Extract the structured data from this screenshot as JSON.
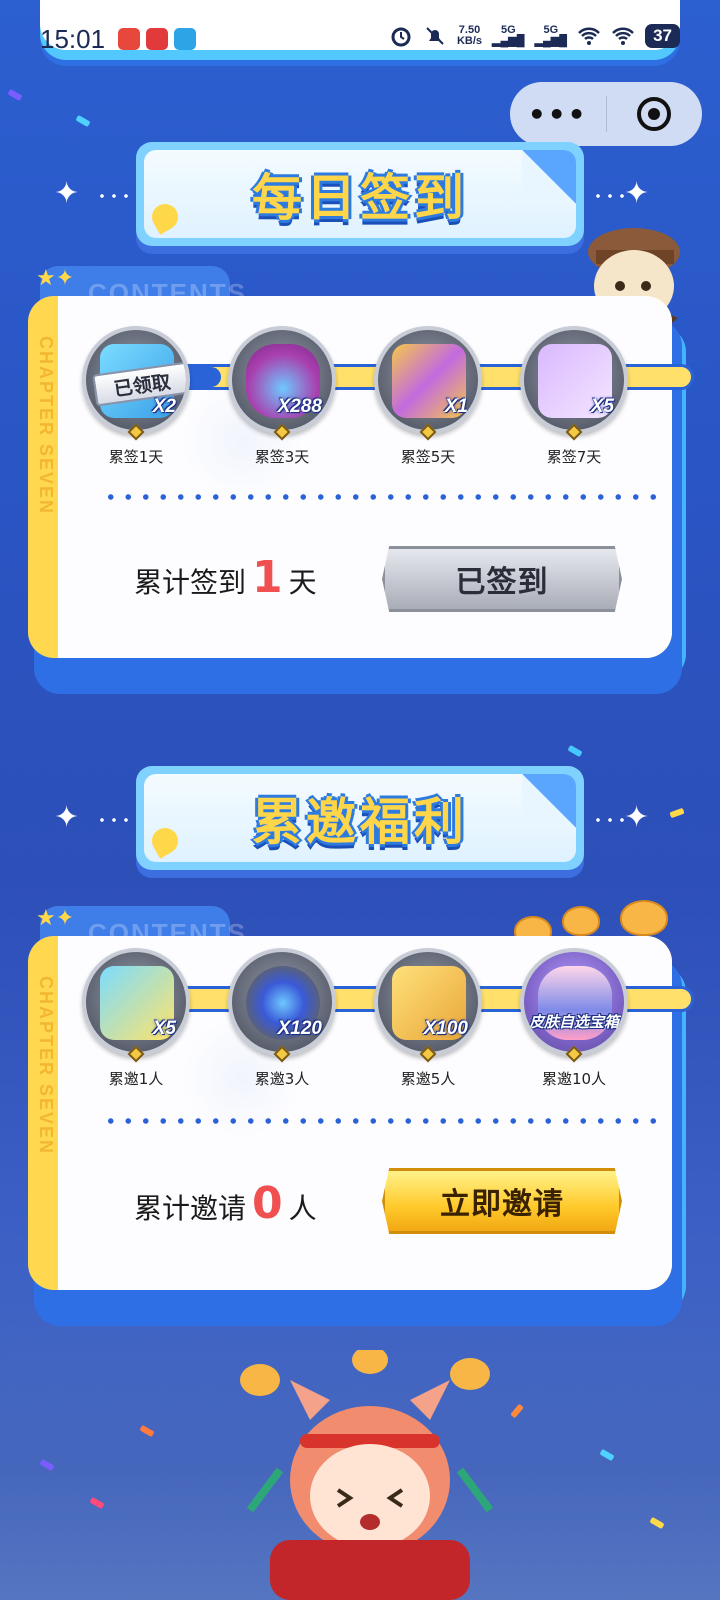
{
  "status_bar": {
    "time": "15:01",
    "net_speed": "7.50",
    "net_unit": "KB/s",
    "sig1": "5G",
    "sig2": "5G",
    "battery": "37"
  },
  "capsule": {
    "more_label": "•••",
    "icons": [
      "more-icon",
      "close-target-icon"
    ]
  },
  "signin_section": {
    "title": "每日签到",
    "tab_text": "CONTENTS",
    "side_text": "CHAPTER SEVEN",
    "rewards": [
      {
        "label": "累签1天",
        "qty": "X2",
        "claimed": "已领取",
        "icon": "ticket-icon"
      },
      {
        "label": "累签3天",
        "qty": "X288",
        "icon": "diamond-bag-icon"
      },
      {
        "label": "累签5天",
        "qty": "X1",
        "icon": "treasure-box-icon"
      },
      {
        "label": "累签7天",
        "qty": "X5",
        "icon": "ticket-icon"
      }
    ],
    "count_prefix": "累计签到",
    "count_value": "1",
    "count_suffix": "天",
    "button_label": "已签到"
  },
  "invite_section": {
    "title": "累邀福利",
    "tab_text": "CONTENTS",
    "side_text": "CHAPTER SEVEN",
    "rewards": [
      {
        "label": "累邀1人",
        "qty": "X5",
        "icon": "ticket-icon"
      },
      {
        "label": "累邀3人",
        "qty": "X120",
        "icon": "gear-orb-icon"
      },
      {
        "label": "累邀5人",
        "qty": "X100",
        "icon": "puzzle-icon"
      },
      {
        "label": "累邀10人",
        "qty": "皮肤自选宝箱",
        "icon": "skin-chest-icon"
      }
    ],
    "count_prefix": "累计邀请",
    "count_value": "0",
    "count_suffix": "人",
    "button_label": "立即邀请"
  },
  "colors": {
    "accent_blue": "#2a63d8",
    "gold": "#ffd850",
    "count_red": "#f05050"
  }
}
